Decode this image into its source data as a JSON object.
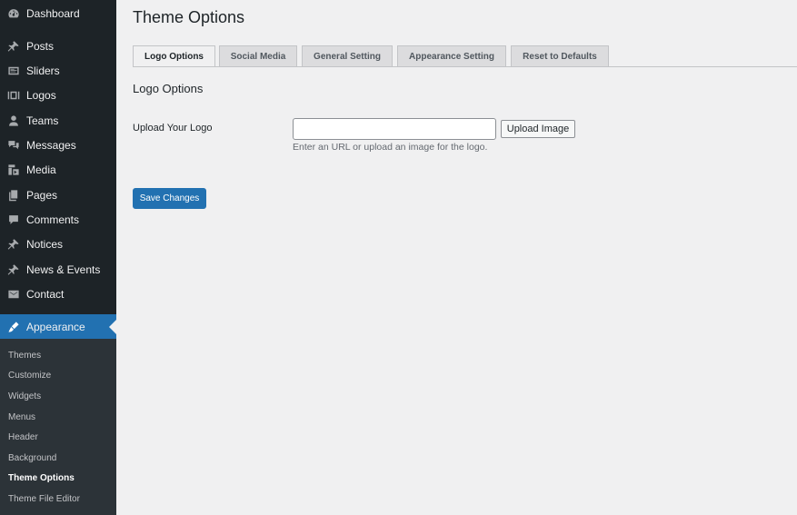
{
  "sidebar": {
    "menu": [
      {
        "label": "Dashboard",
        "icon": "dashboard-icon"
      },
      {
        "label": "Posts",
        "icon": "pin-icon"
      },
      {
        "label": "Sliders",
        "icon": "slider-icon"
      },
      {
        "label": "Logos",
        "icon": "logos-icon"
      },
      {
        "label": "Teams",
        "icon": "person-icon"
      },
      {
        "label": "Messages",
        "icon": "messages-icon"
      },
      {
        "label": "Media",
        "icon": "media-icon"
      },
      {
        "label": "Pages",
        "icon": "pages-icon"
      },
      {
        "label": "Comments",
        "icon": "comment-icon"
      },
      {
        "label": "Notices",
        "icon": "pin-icon"
      },
      {
        "label": "News & Events",
        "icon": "pin-icon"
      },
      {
        "label": "Contact",
        "icon": "mail-icon"
      },
      {
        "label": "Appearance",
        "icon": "brush-icon"
      }
    ],
    "submenu": [
      {
        "label": "Themes"
      },
      {
        "label": "Customize"
      },
      {
        "label": "Widgets"
      },
      {
        "label": "Menus"
      },
      {
        "label": "Header"
      },
      {
        "label": "Background"
      },
      {
        "label": "Theme Options"
      },
      {
        "label": "Theme File Editor"
      }
    ],
    "active_menu": "Appearance",
    "current_submenu": "Theme Options"
  },
  "page": {
    "title": "Theme Options",
    "tabs": [
      {
        "label": "Logo Options"
      },
      {
        "label": "Social Media"
      },
      {
        "label": "General Setting"
      },
      {
        "label": "Appearance Setting"
      },
      {
        "label": "Reset to Defaults"
      }
    ],
    "active_tab": "Logo Options",
    "section_title": "Logo Options",
    "field": {
      "label": "Upload Your Logo",
      "value": "",
      "placeholder": "",
      "upload_button": "Upload Image",
      "helper": "Enter an URL or upload an image for the logo."
    },
    "save_button": "Save Changes"
  },
  "colors": {
    "sidebar_bg": "#1d2327",
    "submenu_bg": "#2c3338",
    "accent": "#2271b1",
    "page_bg": "#f0f0f1"
  }
}
